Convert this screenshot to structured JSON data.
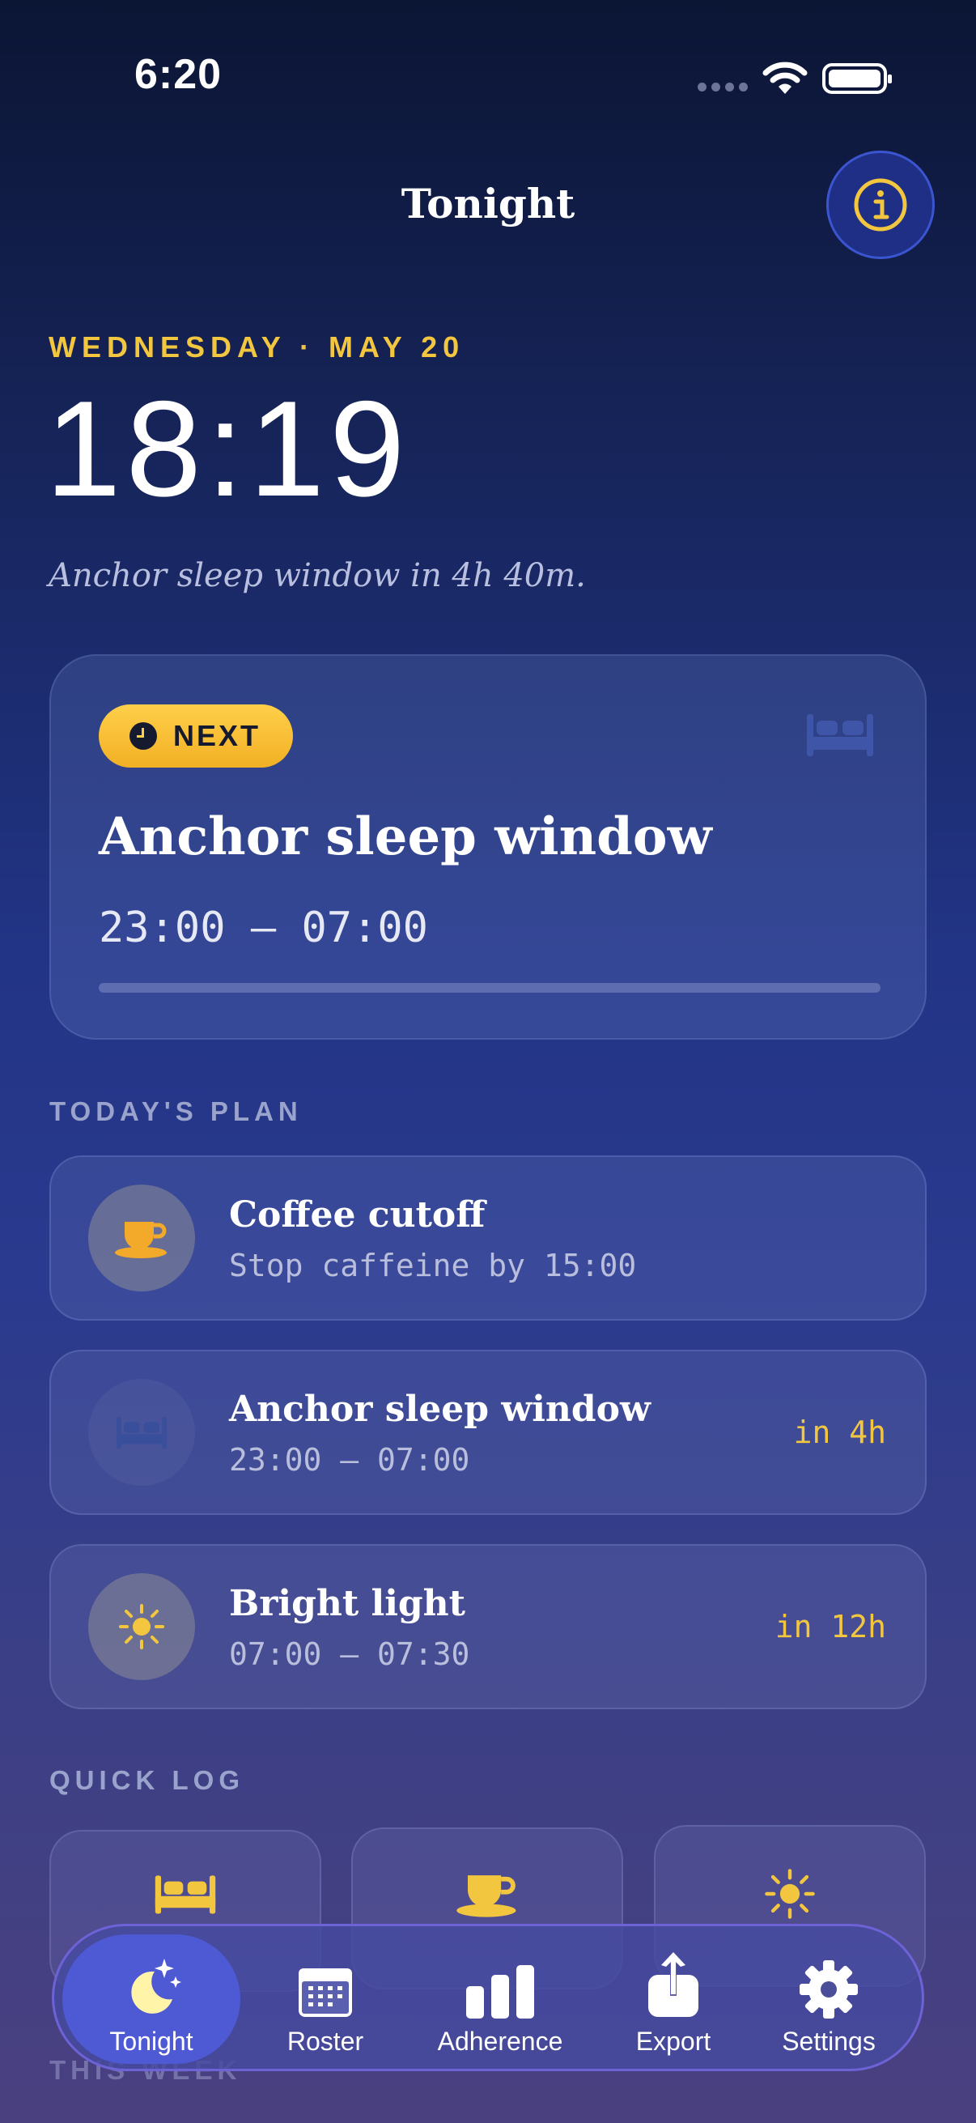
{
  "status_bar": {
    "time": "6:20"
  },
  "header": {
    "title": "Tonight"
  },
  "hero": {
    "date": "WEDNESDAY · MAY 20",
    "clock": "18:19",
    "countdown": "Anchor sleep window in 4h 40m."
  },
  "next_card": {
    "badge": "NEXT",
    "title": "Anchor sleep window",
    "time": "23:00 — 07:00",
    "progress": 0
  },
  "todays_plan": {
    "label": "TODAY'S PLAN",
    "items": [
      {
        "title": "Coffee cutoff",
        "subtitle": "Stop caffeine by 15:00",
        "eta": "",
        "icon": "coffee-icon"
      },
      {
        "title": "Anchor sleep window",
        "subtitle": "23:00 — 07:00",
        "eta": "in 4h",
        "icon": "bed-icon"
      },
      {
        "title": "Bright light",
        "subtitle": "07:00 — 07:30",
        "eta": "in 12h",
        "icon": "sun-icon"
      }
    ]
  },
  "quick_log": {
    "label": "QUICK LOG",
    "items": [
      {
        "icon": "bed-icon"
      },
      {
        "icon": "coffee-icon"
      },
      {
        "icon": "sun-icon"
      }
    ]
  },
  "this_week": {
    "label": "THIS WEEK"
  },
  "tab_bar": {
    "tabs": [
      {
        "label": "Tonight",
        "icon": "moon-stars-icon",
        "active": true
      },
      {
        "label": "Roster",
        "icon": "calendar-icon",
        "active": false
      },
      {
        "label": "Adherence",
        "icon": "bar-chart-icon",
        "active": false
      },
      {
        "label": "Export",
        "icon": "share-icon",
        "active": false
      },
      {
        "label": "Settings",
        "icon": "gear-icon",
        "active": false
      }
    ]
  },
  "colors": {
    "accent": "#f3c640",
    "tab_active": "#4e59d4"
  }
}
